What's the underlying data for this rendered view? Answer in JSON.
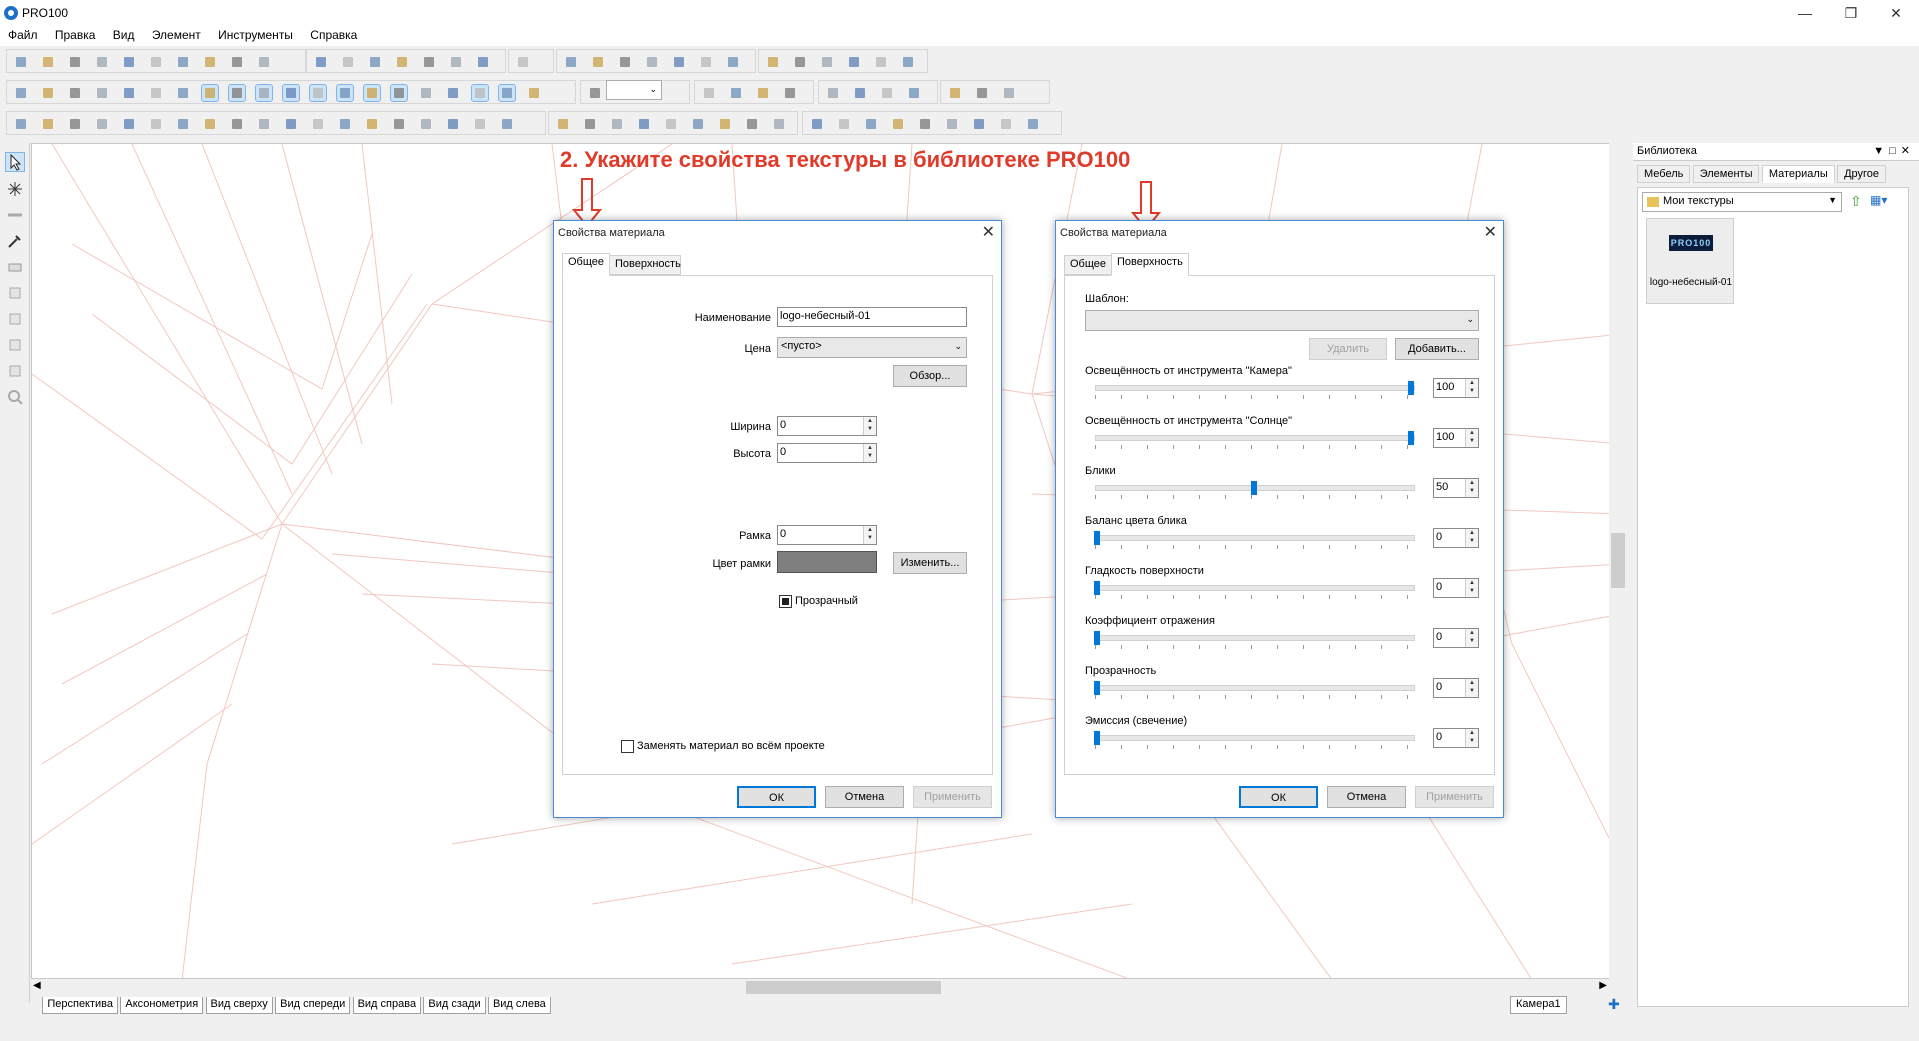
{
  "app": {
    "title": "PRO100",
    "window_controls": [
      "minimize-icon",
      "restore-icon",
      "close-icon"
    ]
  },
  "menu": [
    "Файл",
    "Правка",
    "Вид",
    "Элемент",
    "Инструменты",
    "Справка"
  ],
  "annotation": {
    "text": "2. Укажите свойства текстуры в библиотеке PRO100",
    "color": "#e03b2a"
  },
  "zoom_value": "",
  "view_tabs": [
    "Перспектива",
    "Аксонометрия",
    "Вид сверху",
    "Вид спереди",
    "Вид справа",
    "Вид сзади",
    "Вид слева"
  ],
  "camera_tab": "Камера1",
  "library": {
    "title": "Библиотека",
    "tabs": [
      "Мебель",
      "Элементы",
      "Материалы",
      "Другое"
    ],
    "active_tab": "Материалы",
    "folder": "Мои текстуры",
    "item": {
      "thumb_text": "PRO100",
      "caption": "logo-небесный-01"
    }
  },
  "dialog_general": {
    "title": "Свойства материала",
    "tabs": [
      "Общее",
      "Поверхность"
    ],
    "active_tab": "Общее",
    "name_label": "Наименование",
    "name_value": "logo-небесный-01",
    "price_label": "Цена",
    "price_value": "<пусто>",
    "browse_button": "Обзор...",
    "width_label": "Ширина",
    "width_value": "0",
    "height_label": "Высота",
    "height_value": "0",
    "frame_label": "Рамка",
    "frame_value": "0",
    "frame_color_label": "Цвет рамки",
    "frame_color": "#7f7f7f",
    "change_button": "Изменить...",
    "transparent_label": "Прозрачный",
    "transparent_checked": true,
    "replace_label": "Заменять материал во всём проекте",
    "replace_checked": false,
    "ok": "ОК",
    "cancel": "Отмена",
    "apply": "Применить"
  },
  "dialog_surface": {
    "title": "Свойства материала",
    "tabs": [
      "Общее",
      "Поверхность"
    ],
    "active_tab": "Поверхность",
    "template_label": "Шаблон:",
    "template_value": "",
    "delete_button": "Удалить",
    "add_button": "Добавить...",
    "sliders": [
      {
        "label": "Освещённость от инструмента \"Камера\"",
        "value": "100",
        "level": 1.0
      },
      {
        "label": "Освещённость от инструмента \"Солнце\"",
        "value": "100",
        "level": 1.0
      },
      {
        "label": "Блики",
        "value": "50",
        "level": 0.5
      },
      {
        "label": "Баланс цвета блика",
        "value": "0",
        "level": 0
      },
      {
        "label": "Гладкость поверхности",
        "value": "0",
        "level": 0
      },
      {
        "label": "Коэффициент отражения",
        "value": "0",
        "level": 0
      },
      {
        "label": "Прозрачность",
        "value": "0",
        "level": 0
      },
      {
        "label": "Эмиссия (свечение)",
        "value": "0",
        "level": 0
      }
    ],
    "ok": "ОК",
    "cancel": "Отмена",
    "apply": "Применить"
  }
}
